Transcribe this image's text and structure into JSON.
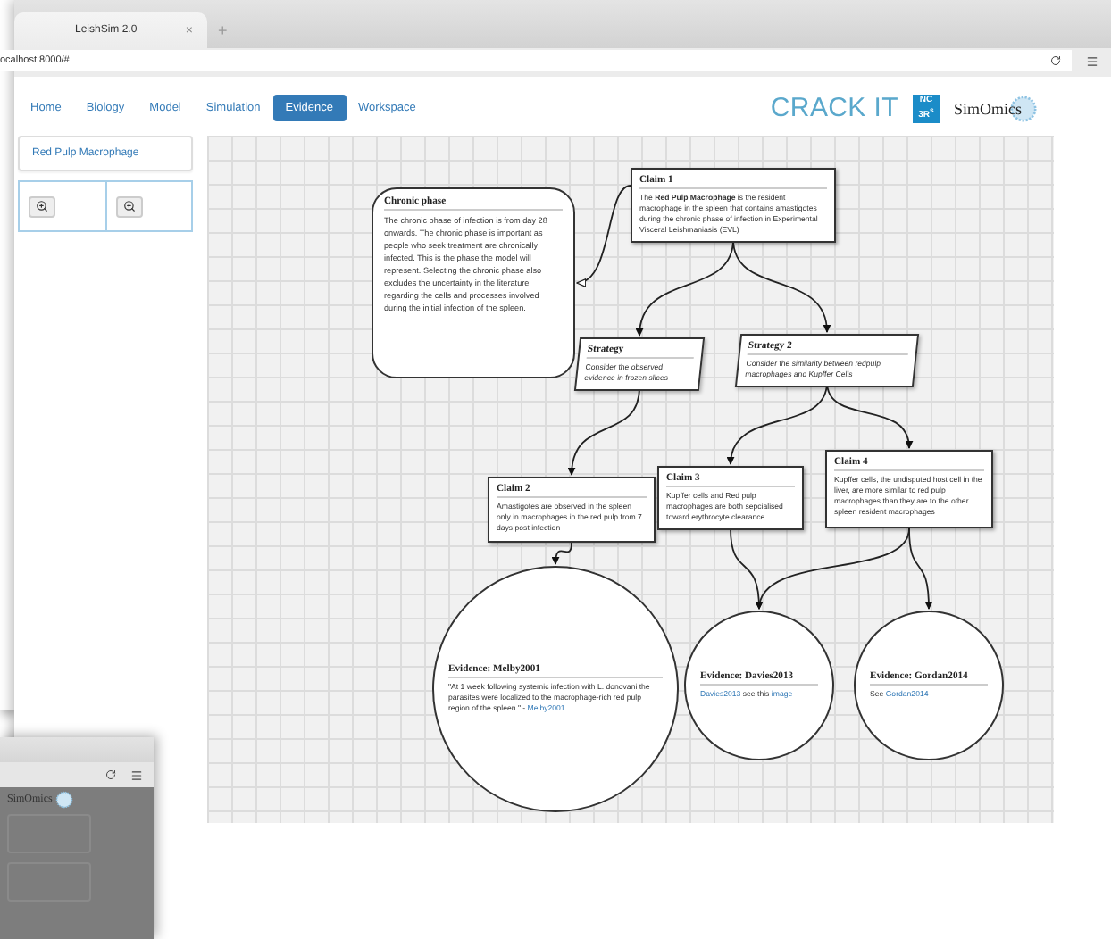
{
  "browser": {
    "tab_title": "LeishSim 2.0",
    "tab_close": "×",
    "new_tab": "+",
    "address": "ocalhost:8000/#"
  },
  "nav": [
    {
      "label": "Home",
      "selected": false
    },
    {
      "label": "Biology",
      "selected": false
    },
    {
      "label": "Model",
      "selected": false
    },
    {
      "label": "Simulation",
      "selected": false
    },
    {
      "label": "Evidence",
      "selected": true
    },
    {
      "label": "Workspace",
      "selected": false
    }
  ],
  "logos": {
    "crack_it": "CRACK IT",
    "nc3rs": [
      "NC",
      "3R$^{s}$"
    ],
    "simomics": "SimOmics"
  },
  "sidebar": {
    "title": "Red Pulp Macrophage"
  },
  "diagram": {
    "nodes": [
      {
        "kind": "context",
        "title": "Chronic phase",
        "body": [
          {
            "text": "The chronic phase of infection is from day 28 onwards. The chronic phase is important as people who seek treatment are chronically infected. This is the phase the model will represent. Selecting the chronic phase also excludes the uncertainty in the literature regarding the cells and processes involved during the initial infection of the spleen.",
            "kind": "text"
          }
        ]
      },
      {
        "kind": "claim",
        "title": "Claim 1",
        "body": [
          {
            "text": "The **Red Pulp Macrophage** is the resident macrophage in the spleen that contains amastigotes during the chronic phase of infection in Experimental Visceral Leishmaniasis (EVL)",
            "kind": "text"
          }
        ]
      },
      {
        "kind": "strategy",
        "title": "Strategy",
        "body": [
          {
            "text": "Consider the observed evidence in frozen slices",
            "kind": "text"
          }
        ]
      },
      {
        "kind": "strategy",
        "title": "Strategy 2",
        "body": [
          {
            "text": "Consider the similarity between redpulp macrophages and Kupffer Cells",
            "kind": "text"
          }
        ]
      },
      {
        "kind": "claim",
        "title": "Claim 2",
        "body": [
          {
            "text": "Amastigotes are observed in the spleen only in macrophages in the red pulp from 7 days post infection",
            "kind": "text"
          }
        ]
      },
      {
        "kind": "claim",
        "title": "Claim 3",
        "body": [
          {
            "text": "Kupffer cells and Red pulp macrophages are both sepcialised toward erythrocyte clearance",
            "kind": "text"
          }
        ]
      },
      {
        "kind": "claim",
        "title": "Claim 4",
        "body": [
          {
            "text": "Kupffer cells, the undisputed host cell in the liver, are more similar to red pulp macrophages than they are to the other spleen resident macrophages",
            "kind": "text"
          }
        ]
      },
      {
        "kind": "evidence",
        "title": "Evidence: Melby2001",
        "body": [
          {
            "text": "\"At 1 week following systemic infection with L. donovani the parasites were localized to the macrophage-rich red pulp region of the spleen.\" - ",
            "kind": "text"
          },
          {
            "text": "Melby2001",
            "kind": "link"
          }
        ]
      },
      {
        "kind": "evidence",
        "title": "Evidence: Davies2013",
        "body": [
          {
            "text": "Davies2013",
            "kind": "link"
          },
          {
            "text": " see this ",
            "kind": "text"
          },
          {
            "text": "image",
            "kind": "link"
          }
        ]
      },
      {
        "kind": "evidence",
        "title": "Evidence: Gordan2014",
        "body": [
          {
            "text": "See ",
            "kind": "text"
          },
          {
            "text": "Gordan2014",
            "kind": "link"
          }
        ]
      }
    ],
    "edges": [
      {
        "kind": "support"
      },
      {
        "kind": "support"
      },
      {
        "kind": "context"
      },
      {
        "kind": "support"
      },
      {
        "kind": "support"
      },
      {
        "kind": "support"
      },
      {
        "kind": "support"
      },
      {
        "kind": "support"
      },
      {
        "kind": "support"
      },
      {
        "kind": "support"
      }
    ]
  },
  "background_window": {
    "logo": "SimOmics"
  }
}
